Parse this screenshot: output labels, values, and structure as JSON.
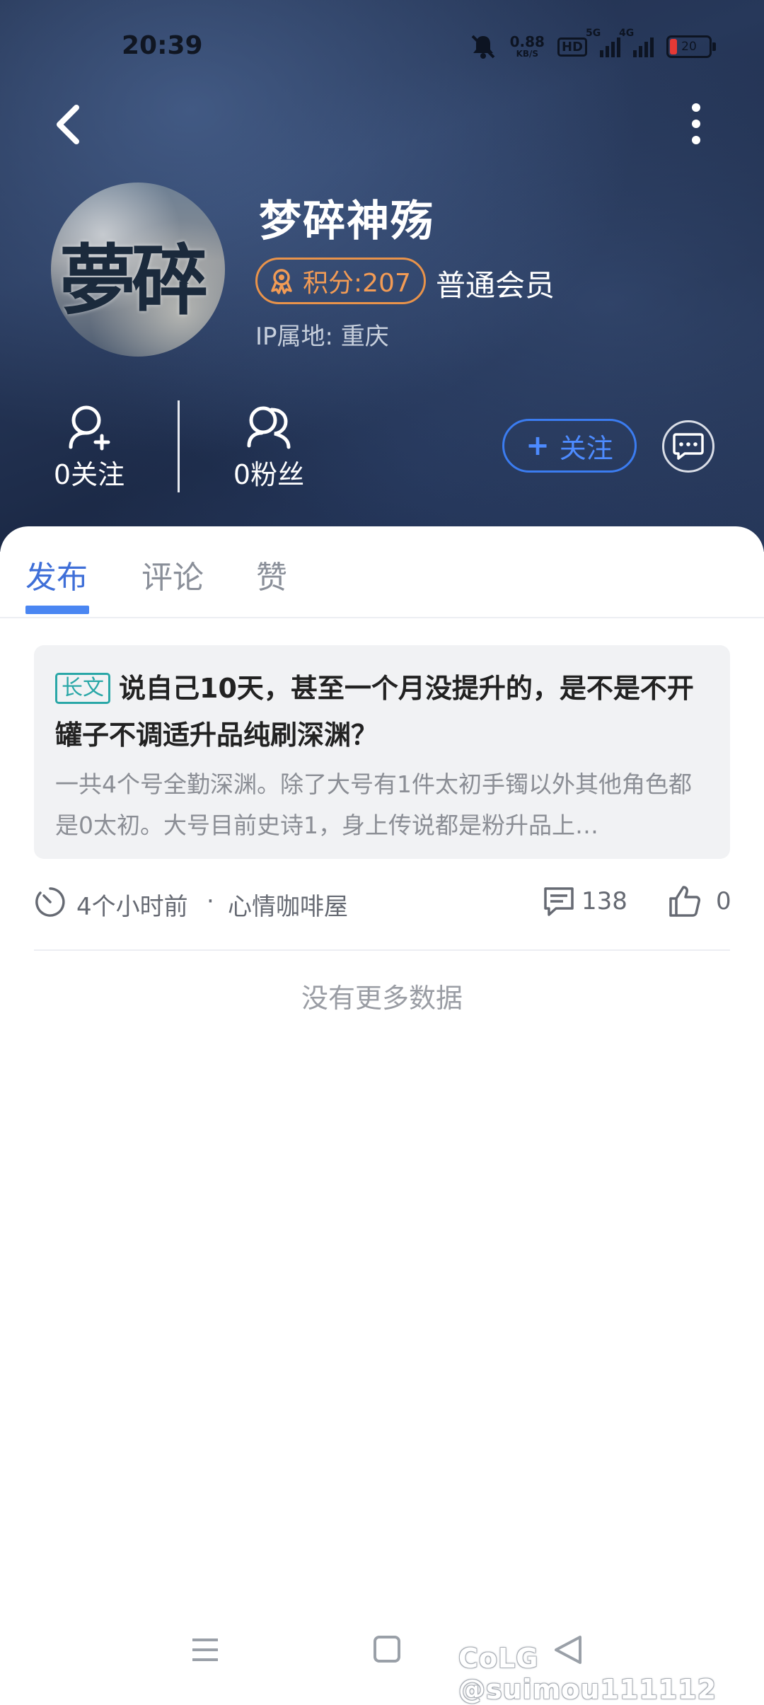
{
  "status_bar": {
    "time": "20:39",
    "net_speed_value": "0.88",
    "net_speed_unit": "KB/S",
    "hd_label": "HD",
    "signal1_label": "5G",
    "signal2_label": "4G",
    "battery": "20"
  },
  "profile": {
    "username": "梦碎神殇",
    "avatar_text": "夢碎",
    "points_label": "积分:207",
    "member_level": "普通会员",
    "ip_location": "IP属地: 重庆",
    "following": "0关注",
    "fans": "0粉丝",
    "follow_button": "关注",
    "follow_plus": "+"
  },
  "tabs": [
    {
      "label": "发布"
    },
    {
      "label": "评论"
    },
    {
      "label": "赞"
    }
  ],
  "post": {
    "tag": "长文",
    "title": "说自己10天，甚至一个月没提升的，是不是不开罐子不调适升品纯刷深渊？",
    "excerpt": "一共4个号全勤深渊。除了大号有1件太初手镯以外其他角色都是0太初。大号目前史诗1，身上传说都是粉升品上…",
    "time_ago": "4个小时前",
    "separator": "·",
    "forum": "心情咖啡屋",
    "comments": "138",
    "likes": "0"
  },
  "no_more_text": "没有更多数据",
  "watermark": "CoLG @suimou111112",
  "colors": {
    "accent": "#4a86f2",
    "points": "#f29b55",
    "tag": "#2aa7a7",
    "hero_bg": "#23334f"
  }
}
